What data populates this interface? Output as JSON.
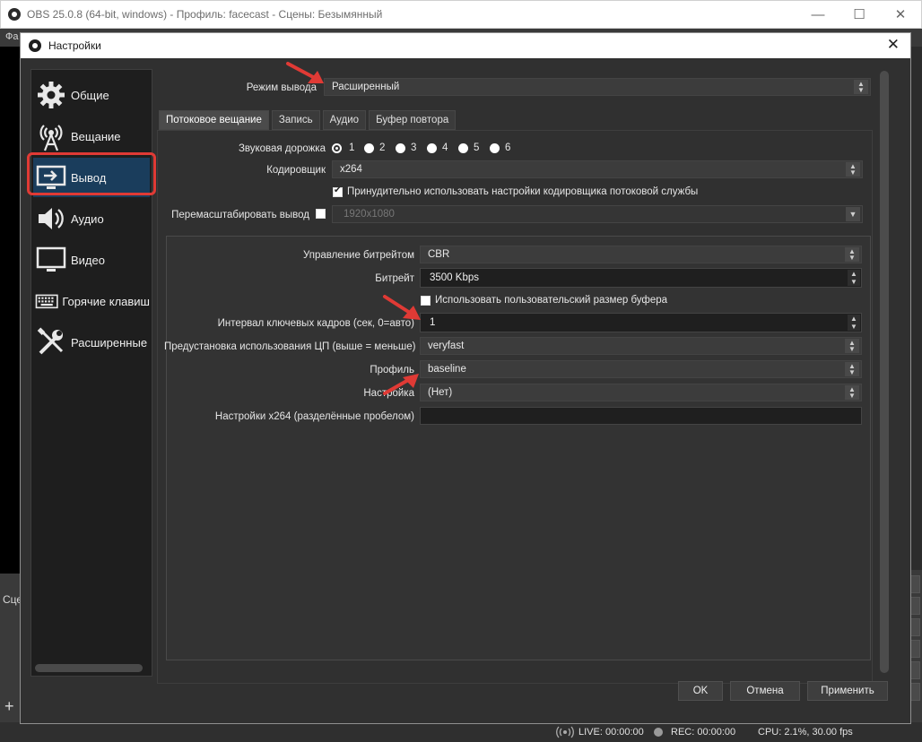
{
  "main_window": {
    "title": "OBS 25.0.8 (64-bit, windows) - Профиль: facecast - Сцены: Безымянный",
    "menu_file": "Фа",
    "scenes_label": "Сце",
    "add_label": "+",
    "minimize": "—",
    "maximize": "☐",
    "close": "✕"
  },
  "statusbar": {
    "live": "LIVE: 00:00:00",
    "rec": "REC: 00:00:00",
    "cpu": "CPU: 2.1%, 30.00 fps"
  },
  "dialog": {
    "title": "Настройки",
    "close": "✕"
  },
  "sidebar": {
    "items": [
      {
        "label": "Общие",
        "icon": "gear-icon"
      },
      {
        "label": "Вещание",
        "icon": "broadcast-icon"
      },
      {
        "label": "Вывод",
        "icon": "output-icon",
        "active": true
      },
      {
        "label": "Аудио",
        "icon": "speaker-icon"
      },
      {
        "label": "Видео",
        "icon": "monitor-icon"
      },
      {
        "label": "Горячие клавиш",
        "icon": "keyboard-icon"
      },
      {
        "label": "Расширенные",
        "icon": "tools-icon"
      }
    ]
  },
  "output_mode": {
    "label": "Режим вывода",
    "value": "Расширенный"
  },
  "tabs": [
    {
      "label": "Потоковое вещание",
      "active": true
    },
    {
      "label": "Запись"
    },
    {
      "label": "Аудио"
    },
    {
      "label": "Буфер повтора"
    }
  ],
  "streaming": {
    "audio_track_label": "Звуковая дорожка",
    "audio_tracks": [
      "1",
      "2",
      "3",
      "4",
      "5",
      "6"
    ],
    "encoder_label": "Кодировщик",
    "encoder_value": "x264",
    "enforce_label": "Принудительно использовать настройки кодировщика потоковой службы",
    "rescale_label": "Перемасштабировать вывод",
    "rescale_value": "1920x1080"
  },
  "encoder_settings": {
    "rate_control_label": "Управление битрейтом",
    "rate_control_value": "CBR",
    "bitrate_label": "Битрейт",
    "bitrate_value": "3500 Kbps",
    "custom_buffer_label": "Использовать пользовательский размер буфера",
    "keyframe_label": "Интервал ключевых кадров (сек, 0=авто)",
    "keyframe_value": "1",
    "cpu_preset_label": "Предустановка использования ЦП (выше = меньше)",
    "cpu_preset_value": "veryfast",
    "profile_label": "Профиль",
    "profile_value": "baseline",
    "tune_label": "Настройка",
    "tune_value": "(Нет)",
    "x264_options_label": "Настройки x264 (разделённые пробелом)"
  },
  "buttons": {
    "ok": "OK",
    "cancel": "Отмена",
    "apply": "Применить"
  },
  "colors": {
    "active_sidebar": "#1a3d5c",
    "highlight_red": "#e03a35"
  }
}
